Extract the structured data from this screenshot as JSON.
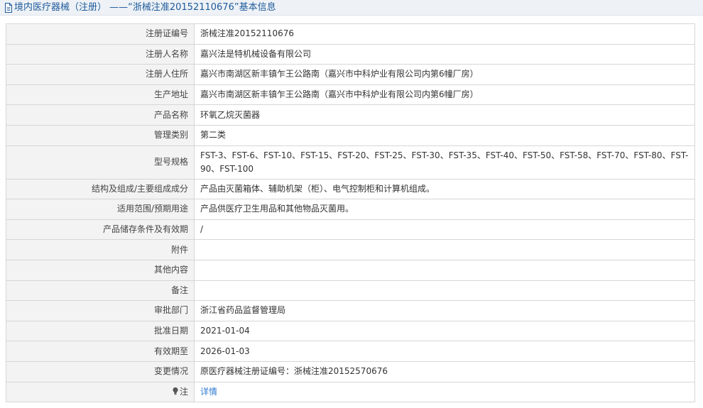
{
  "page": {
    "title": "境内医疗器械（注册） ——“浙械注准20152110676”基本信息"
  },
  "rows": [
    {
      "label": "注册证编号",
      "value": "浙械注准20152110676"
    },
    {
      "label": "注册人名称",
      "value": "嘉兴法是特机械设备有限公司"
    },
    {
      "label": "注册人住所",
      "value": "嘉兴市南湖区新丰镇乍王公路南（嘉兴市中科炉业有限公司内第6幢厂房）"
    },
    {
      "label": "生产地址",
      "value": "嘉兴市南湖区新丰镇乍王公路南（嘉兴市中科炉业有限公司内第6幢厂房）"
    },
    {
      "label": "产品名称",
      "value": "环氧乙烷灭菌器"
    },
    {
      "label": "管理类别",
      "value": "第二类"
    },
    {
      "label": "型号规格",
      "value": "FST-3、FST-6、FST-10、FST-15、FST-20、FST-25、FST-30、FST-35、FST-40、FST-50、FST-58、FST-70、FST-80、FST-90、FST-100"
    },
    {
      "label": "结构及组成/主要组成成分",
      "value": "产品由灭菌箱体、辅助机架（柜）、电气控制柜和计算机组成。"
    },
    {
      "label": "适用范围/预期用途",
      "value": "产品供医疗卫生用品和其他物品灭菌用。"
    },
    {
      "label": "产品储存条件及有效期",
      "value": "/"
    },
    {
      "label": "附件",
      "value": ""
    },
    {
      "label": "其他内容",
      "value": ""
    },
    {
      "label": "备注",
      "value": ""
    },
    {
      "label": "审批部门",
      "value": "浙江省药品监督管理局"
    },
    {
      "label": "批准日期",
      "value": "2021-01-04"
    },
    {
      "label": "有效期至",
      "value": "2026-01-03"
    },
    {
      "label": "变更情况",
      "value": "原医疗器械注册证编号：浙械注准20152570676"
    }
  ],
  "note": {
    "label": "注",
    "link_text": "详情"
  },
  "colors": {
    "title_text": "#1e5a9a",
    "title_bg": "#eef2f6",
    "label_bg": "#f3f3f3",
    "border": "#d6d6d6",
    "link": "#2f7bd0"
  }
}
